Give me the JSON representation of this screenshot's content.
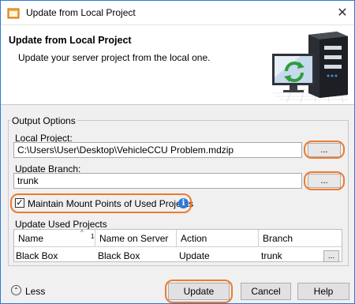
{
  "window": {
    "title": "Update from Local Project"
  },
  "header": {
    "title": "Update from Local Project",
    "description": "Update your server project from the local one."
  },
  "output_options": {
    "legend": "Output Options",
    "local_project_label": "Local Project:",
    "local_project_value": "C:\\Users\\User\\Desktop\\VehicleCCU Problem.mdzip",
    "update_branch_label": "Update Branch:",
    "update_branch_value": "trunk",
    "browse_label": "...",
    "maintain_mount_label": "Maintain Mount Points of Used Projects",
    "maintain_mount_checked": true,
    "update_used_projects_label": "Update Used Projects"
  },
  "table": {
    "columns": [
      "Name",
      "Name on Server",
      "Action",
      "Branch"
    ],
    "sort_indicator": "1",
    "rows": [
      {
        "name": "Black Box",
        "name_on_server": "Black Box",
        "action": "Update",
        "branch": "trunk",
        "more": "..."
      }
    ]
  },
  "footer": {
    "less_label": "Less",
    "update_button": "Update",
    "cancel_button": "Cancel",
    "help_button": "Help"
  },
  "colors": {
    "highlight": "#ee7a2e",
    "title_border": "#2b79d8",
    "info": "#2d7ad6"
  },
  "icons": [
    "app-icon",
    "close-icon",
    "server-sync-image",
    "checkbox-check-icon",
    "info-icon",
    "sort-ascending-icon",
    "less-chevron-up-icon"
  ]
}
